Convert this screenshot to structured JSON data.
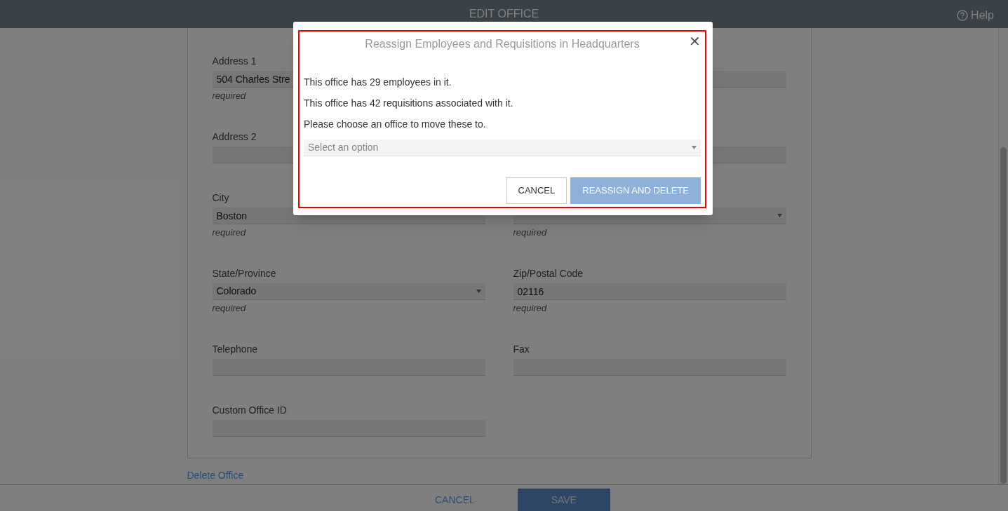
{
  "header": {
    "title": "EDIT OFFICE",
    "help": "Help"
  },
  "form": {
    "rows": [
      {
        "left": {
          "label": "Address 1",
          "kind": "text",
          "value": "504 Charles Stre",
          "note": "required"
        },
        "right": {
          "kind": "text"
        }
      },
      {
        "left": {
          "label": "Address 2",
          "kind": "text"
        },
        "right": {
          "kind": "text"
        }
      },
      {
        "left": {
          "label": "City",
          "kind": "text",
          "value": "Boston",
          "note": "required"
        },
        "right": {
          "kind": "select",
          "note": "required"
        }
      },
      {
        "left": {
          "label": "State/Province",
          "kind": "select",
          "value": "Colorado",
          "note": "required"
        },
        "right": {
          "label": "Zip/Postal Code",
          "kind": "text",
          "value": "02116",
          "note": "required"
        }
      },
      {
        "left": {
          "label": "Telephone",
          "kind": "text"
        },
        "right": {
          "label": "Fax",
          "kind": "text"
        }
      },
      {
        "left": {
          "label": "Custom Office ID",
          "kind": "text"
        }
      }
    ],
    "delete_link": "Delete Office"
  },
  "footer": {
    "cancel": "CANCEL",
    "save": "SAVE"
  },
  "modal": {
    "title": "Reassign Employees and Requisitions in Headquarters",
    "close": "✕",
    "messages": [
      "This office has 29 employees in it.",
      "This office has 42 requisitions associated with it.",
      "Please choose an office to move these to."
    ],
    "select": {
      "placeholder": "Select an option"
    },
    "buttons": [
      {
        "label": "CANCEL",
        "kind": "secondary",
        "disabled": false
      },
      {
        "label": "REASSIGN AND DELETE",
        "kind": "primary",
        "disabled": true
      }
    ]
  }
}
